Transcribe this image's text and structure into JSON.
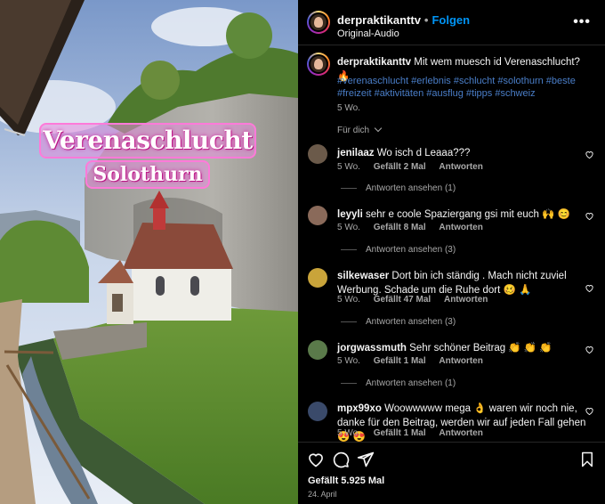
{
  "media": {
    "title_overlay": "Verenaschlucht",
    "subtitle_overlay": "Solothurn"
  },
  "header": {
    "username": "derpraktikanttv",
    "separator": "•",
    "follow_label": "Folgen",
    "audio_label": "Original-Audio",
    "more_icon": "more-horizontal-icon"
  },
  "caption": {
    "username": "derpraktikanttv",
    "text": "Mit wem muesch id Verenaschlucht? 🔥",
    "hashtags": "#verenaschlucht #erlebnis #schlucht #solothurn #beste #freizeit #aktivitäten #ausflug #tipps #schweiz",
    "time": "5 Wo."
  },
  "for_you_label": "Für dich",
  "comments": [
    {
      "username": "jenilaaz",
      "text": "Wo isch d Leaaa???",
      "time": "5 Wo.",
      "likes": "Gefällt 2 Mal",
      "reply_label": "Antworten",
      "view_replies": "Antworten ansehen (1)",
      "avatar_color": "#6b5a4a"
    },
    {
      "username": "leyyli",
      "text": "sehr e coole Spaziergang gsi mit euch 🙌 😊",
      "time": "5 Wo.",
      "likes": "Gefällt 8 Mal",
      "reply_label": "Antworten",
      "view_replies": "Antworten ansehen (3)",
      "avatar_color": "#8a6a5a"
    },
    {
      "username": "silkewaser",
      "text": "Dort bin ich ständig . Mach nicht zuviel Werbung. Schade um die Ruhe dort 🥴 🙏",
      "time": "5 Wo.",
      "likes": "Gefällt 47 Mal",
      "reply_label": "Antworten",
      "view_replies": "Antworten ansehen (3)",
      "avatar_color": "#c9a43a"
    },
    {
      "username": "jorgwassmuth",
      "text": "Sehr schöner Beitrag 👏 👏 👏",
      "time": "5 Wo.",
      "likes": "Gefällt 1 Mal",
      "reply_label": "Antworten",
      "view_replies": "Antworten ansehen (1)",
      "avatar_color": "#5a7a4a"
    },
    {
      "username": "mpx99xo",
      "text": "Woowwwww mega 👌 waren wir noch nie, danke für den Beitrag, werden wir auf jeden Fall gehen 😍 😍",
      "time": "5 Wo.",
      "likes": "Gefällt 1 Mal",
      "reply_label": "Antworten",
      "avatar_color": "#3a4a6a"
    }
  ],
  "footer": {
    "likes": "Gefällt 5.925 Mal",
    "date": "24. April"
  },
  "colors": {
    "accent": "#0095f6",
    "hashtag": "#4a7ec8",
    "muted": "#a8a8a8",
    "overlay_pink": "#ff7ad9"
  }
}
